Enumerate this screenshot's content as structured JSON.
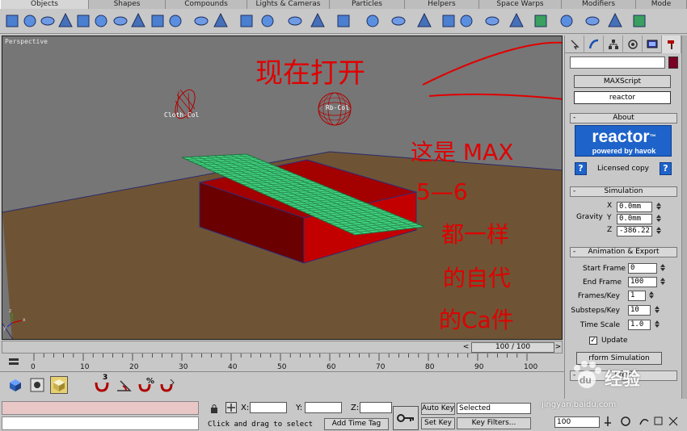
{
  "tabs": [
    {
      "label": "Objects",
      "width": 110,
      "active": true
    },
    {
      "label": "Shapes",
      "width": 95
    },
    {
      "label": "Compounds",
      "width": 101
    },
    {
      "label": "Lights & Cameras",
      "width": 102
    },
    {
      "label": "Particles",
      "width": 93
    },
    {
      "label": "Helpers",
      "width": 92
    },
    {
      "label": "Space Warps",
      "width": 102
    },
    {
      "label": "Modifiers",
      "width": 92
    },
    {
      "label": "Mode",
      "width": 63
    }
  ],
  "viewport": {
    "label": "Perspective",
    "objects": {
      "cloth_label": "Cloth-Col",
      "rb_label": "Rb-Col"
    },
    "axis": {
      "x": "x",
      "y": "y",
      "z": "z"
    }
  },
  "annotations": {
    "line1": "现在打开",
    "line2": "这是 MAX",
    "line3": "5—6",
    "line4": "都一样",
    "line5": "的自代",
    "line6": "的Ca件"
  },
  "panel": {
    "maxscript_label": "MAXScript",
    "reactor_label": "reactor",
    "about": {
      "title": "About",
      "logo_main": "reactor",
      "logo_tm": "™",
      "logo_sub": "powered by havok",
      "licensed": "Licensed copy",
      "help": "?"
    },
    "simulation": {
      "title": "Simulation",
      "gravity_label": "Gravity",
      "x_label": "X",
      "y_label": "Y",
      "z_label": "Z",
      "x": "0.0mm",
      "y": "0.0mm",
      "z": "-386.22"
    },
    "anim_export": {
      "title": "Animation & Export",
      "start_frame_label": "Start Frame",
      "start_frame": "0",
      "end_frame_label": "End Frame",
      "end_frame": "100",
      "frames_key_label": "Frames/Key",
      "frames_key": "1",
      "substeps_label": "Substeps/Key",
      "substeps": "10",
      "time_scale_label": "Time Scale",
      "time_scale": "1.0",
      "update_label": "Update",
      "update_checked": true,
      "perform_button": "rform Simulation"
    },
    "minus": "-",
    "preview_partial": "Previ"
  },
  "timeline": {
    "slider_text": "100 / 100",
    "ticks": [
      0,
      10,
      20,
      30,
      40,
      50,
      60,
      70,
      80,
      90,
      100
    ],
    "arrow_left": "<",
    "arrow_right": ">"
  },
  "bottom": {
    "x_label": "X:",
    "y_label": "Y:",
    "z_label": "Z:",
    "auto_key": "Auto Key",
    "selected": "Selected",
    "set_key": "Set Key",
    "key_filters": "Key Filters...",
    "status_prompt": "Click and drag to select",
    "add_time_tag": "Add Time Tag",
    "frame_value": "100",
    "snap_label": "3"
  },
  "watermark": {
    "brand": "经验",
    "url": "jingyan.baidu.com"
  },
  "colors": {
    "annotation": "#e00000",
    "floor": "#6e5435",
    "box_front": "#c10000",
    "cloth": "#3fcf7c",
    "panel_bg": "#c8c8c8",
    "reactor_blue": "#1e63c9"
  }
}
